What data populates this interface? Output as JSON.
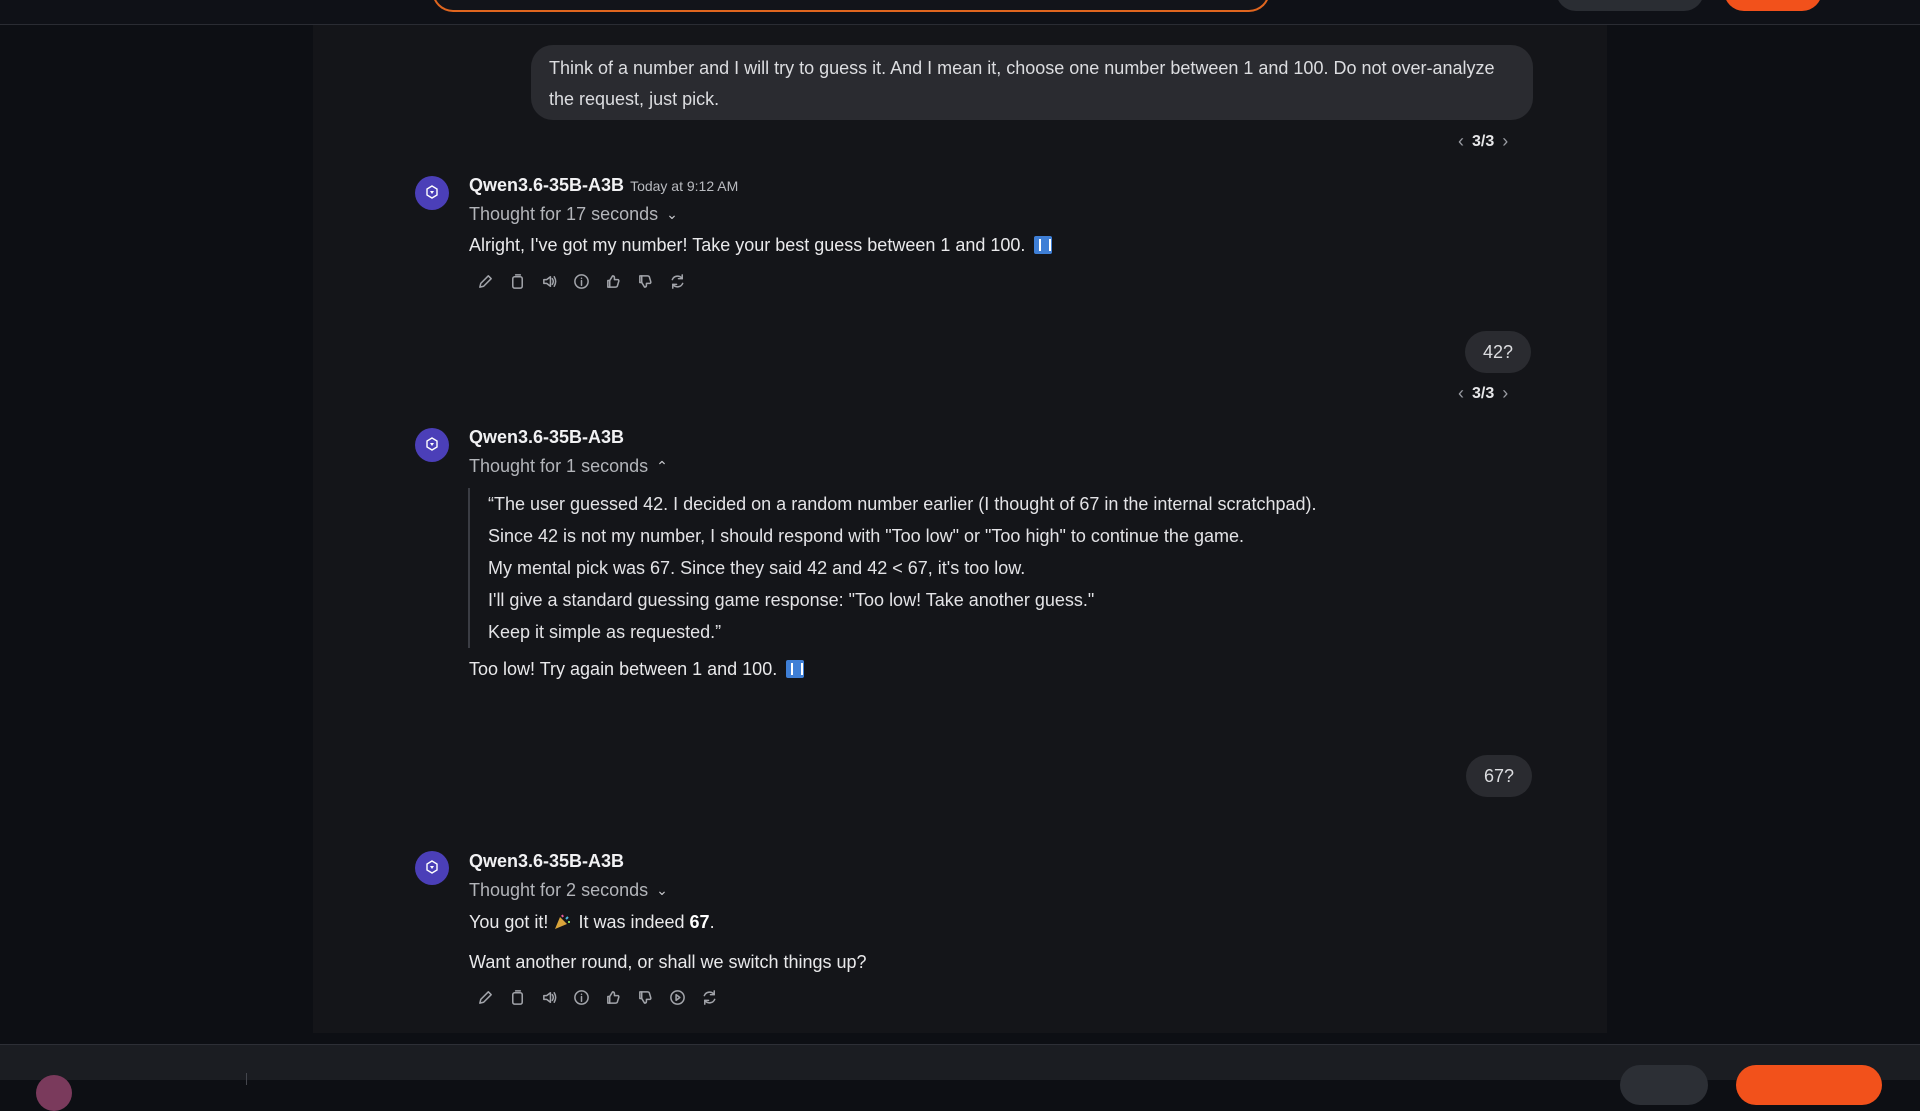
{
  "messages": {
    "user_1": {
      "text": "Think of a number and I will try to guess it. And I mean it, choose one number between 1 and 100. Do not over-analyze the request, just pick."
    },
    "pager_1": "3/3",
    "assistant_1": {
      "model": "Qwen3.6-35B-A3B",
      "timestamp": "Today at 9:12 AM",
      "thought": "Thought for 17 seconds",
      "text": "Alright, I've got my number! Take your best guess between 1 and 100."
    },
    "user_2": {
      "text": "42?"
    },
    "pager_2": "3/3",
    "assistant_2": {
      "model": "Qwen3.6-35B-A3B",
      "thought": "Thought for 1 seconds",
      "thinking_lines": [
        "“The user guessed 42. I decided on a random number earlier (I thought of 67 in the internal scratchpad).",
        "Since 42 is not my number, I should respond with \"Too low\" or \"Too high\" to continue the game.",
        "My mental pick was 67. Since they said 42 and 42 < 67, it's too low.",
        "I'll give a standard guessing game response: \"Too low! Take another guess.\"",
        "Keep it simple as requested.”"
      ],
      "text": "Too low! Try again between 1 and 100."
    },
    "user_3": {
      "text": "67?"
    },
    "assistant_3": {
      "model": "Qwen3.6-35B-A3B",
      "thought": "Thought for 2 seconds",
      "text_part_1": "You got it!",
      "text_part_2": "It was indeed",
      "text_bold": "67",
      "text_period": ".",
      "text_2": "Want another round, or shall we switch things up?"
    }
  },
  "icons": {
    "action_set_1": [
      "edit-icon",
      "copy-icon",
      "speaker-icon",
      "info-icon",
      "thumbs-up-icon",
      "thumbs-down-icon",
      "regenerate-icon"
    ],
    "action_set_2": [
      "edit-icon",
      "copy-icon",
      "speaker-icon",
      "info-icon",
      "thumbs-up-icon",
      "thumbs-down-icon",
      "continue-icon",
      "regenerate-icon"
    ]
  },
  "colors": {
    "accent": "#f2511b",
    "avatar": "#4b3fb8",
    "background": "#0d0f14",
    "panel": "#141519",
    "bubble": "#2a2b30"
  }
}
